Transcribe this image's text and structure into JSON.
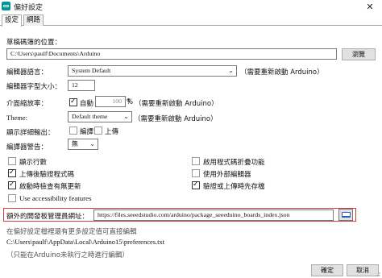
{
  "window": {
    "title": "偏好設定",
    "close": "✕"
  },
  "tabs": [
    {
      "label": "設定"
    },
    {
      "label": "網路"
    }
  ],
  "sketchbook": {
    "label": "草稿碼簿的位置：",
    "path": "C:\\Users\\paulf\\Documents\\Arduino",
    "browse": "瀏覽"
  },
  "editor_language": {
    "label": "編輯器語言：",
    "value": "System Default",
    "note": "（需要重新啟動 Arduino）"
  },
  "font_size": {
    "label": "編輯器字型大小：",
    "value": "12"
  },
  "interface_scale": {
    "label": "介面縮放率：",
    "auto_label": "自動",
    "auto_checked": true,
    "value": "100",
    "unit": "%",
    "note": "（需要重新啟動 Arduino）"
  },
  "theme": {
    "label": "Theme:",
    "value": "Default theme",
    "note": "（需要重新啟動 Arduino）"
  },
  "verbose": {
    "label": "顯示詳細輸出：",
    "compile_label": "編譯",
    "compile_checked": false,
    "upload_label": "上傳",
    "upload_checked": false
  },
  "compiler_warnings": {
    "label": "編譯器警告：",
    "value": "無"
  },
  "options": [
    {
      "label": "顯示行數",
      "checked": false
    },
    {
      "label": "啟用程式碼折疊功能",
      "checked": false
    },
    {
      "label": "上傳後驗證程式碼",
      "checked": true
    },
    {
      "label": "使用外部編輯器",
      "checked": false
    },
    {
      "label": "啟動時檢查有無更新",
      "checked": true
    },
    {
      "label": "驗證或上傳時先存檔",
      "checked": true
    },
    {
      "label": "Use accessibility features",
      "checked": false
    }
  ],
  "board_urls": {
    "label": "額外的開發板管理員網址：",
    "value": "https://files.seeedstudio.com/arduino/package_seeeduino_boards_index.json"
  },
  "info": {
    "more_prefs": "在偏好設定檔裡還有更多設定值可直接編輯",
    "prefs_path": "C:\\Users\\paulf\\AppData\\Local\\Arduino15\\preferences.txt",
    "edit_note": "（只能在Arduino未執行之時進行編輯）"
  },
  "buttons": {
    "ok": "確定",
    "cancel": "取消"
  },
  "colors": {
    "highlight": "#d63a3a",
    "folder_icon": "#2b5bb5",
    "app_icon": "#00979c"
  }
}
